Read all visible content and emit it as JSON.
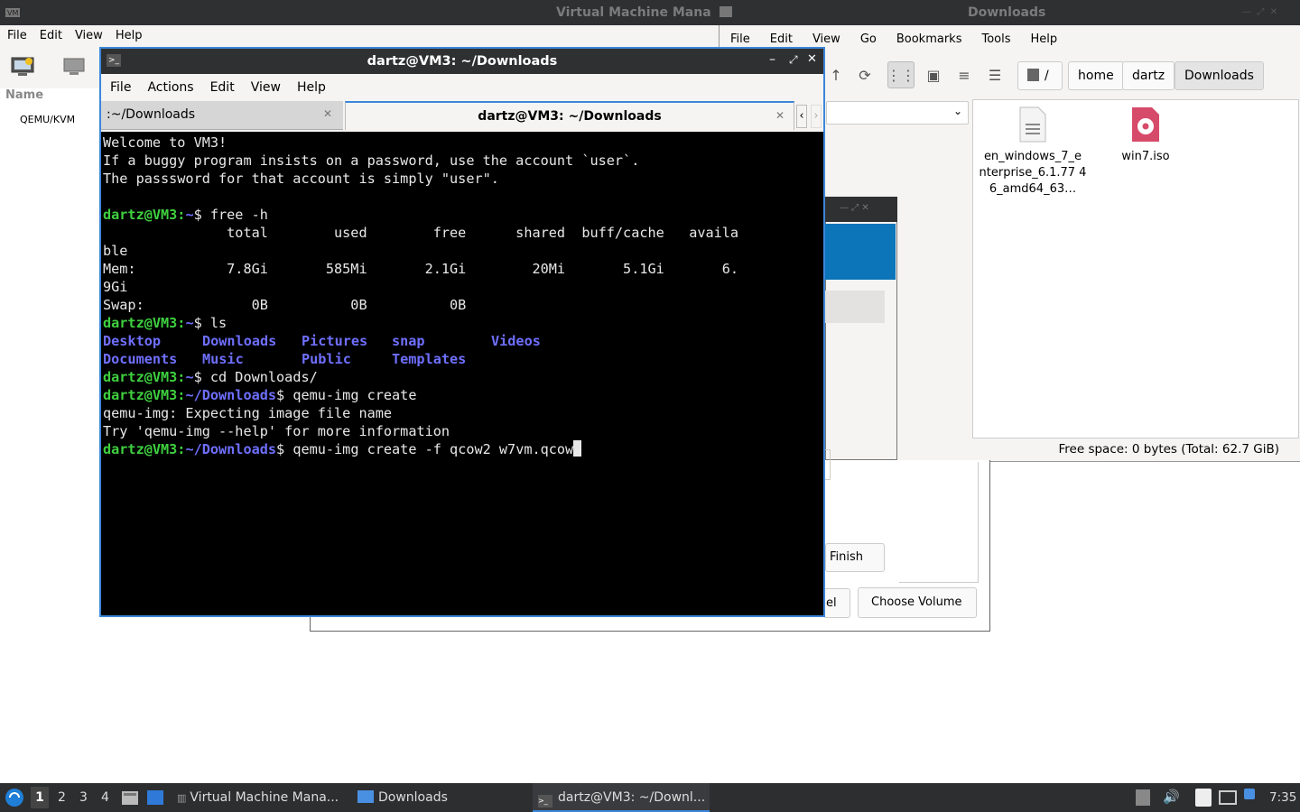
{
  "vmm": {
    "title": "Virtual Machine Mana",
    "menu": [
      "File",
      "Edit",
      "View",
      "Help"
    ],
    "list_header": "Name",
    "connection": "QEMU/KVM"
  },
  "file_manager": {
    "title": "Downloads",
    "menu": [
      "File",
      "Edit",
      "View",
      "Go",
      "Bookmarks",
      "Tools",
      "Help"
    ],
    "path": [
      "/",
      "home",
      "dartz",
      "Downloads"
    ],
    "files": [
      {
        "name": "en_windows_7_e nterprise_6.1.77 46_amd64_63…",
        "icon": "text-file-icon"
      },
      {
        "name": "win7.iso",
        "icon": "disc-image-icon"
      }
    ],
    "status": "Free space: 0 bytes (Total: 62.7 GiB)"
  },
  "dialog": {
    "finish": "Finish",
    "cancel": "el",
    "choose_volume": "Choose Volume"
  },
  "terminal": {
    "title": "dartz@VM3: ~/Downloads",
    "menu": [
      "File",
      "Actions",
      "Edit",
      "View",
      "Help"
    ],
    "tabs": [
      {
        "label": ":~/Downloads",
        "active": false
      },
      {
        "label": "dartz@VM3: ~/Downloads",
        "active": true
      }
    ],
    "lines": {
      "l1": "Welcome to VM3!",
      "l2": "If a buggy program insists on a password, use the account `user`.",
      "l3": "The passsword for that account is simply \"user\".",
      "prompt_home": "dartz@VM3:",
      "tilde": "~",
      "cmd_free": "$ free -h",
      "free_header": "               total        used        free      shared  buff/cache   availa",
      "free_header2": "ble",
      "free_mem": "Mem:           7.8Gi       585Mi       2.1Gi        20Mi       5.1Gi       6.",
      "free_mem2": "9Gi",
      "free_swap": "Swap:             0B          0B          0B",
      "cmd_ls": "$ ls",
      "ls_row1": [
        "Desktop",
        "Downloads",
        "Pictures",
        "snap",
        "Videos"
      ],
      "ls_row2": [
        "Documents",
        "Music",
        "Public",
        "Templates"
      ],
      "cmd_cd": "$ cd Downloads/",
      "dl_path": "~/Downloads",
      "cmd_qemu": "$ qemu-img create",
      "err1": "qemu-img: Expecting image file name",
      "err2": "Try 'qemu-img --help' for more information",
      "cmd_qemu2": "$ qemu-img create -f qcow2 w7vm.qcow"
    }
  },
  "taskbar": {
    "workspaces": [
      "1",
      "2",
      "3",
      "4"
    ],
    "tasks": [
      "Virtual Machine Mana...",
      "Downloads",
      "dartz@VM3: ~/Downl..."
    ],
    "clock": "7:35"
  }
}
